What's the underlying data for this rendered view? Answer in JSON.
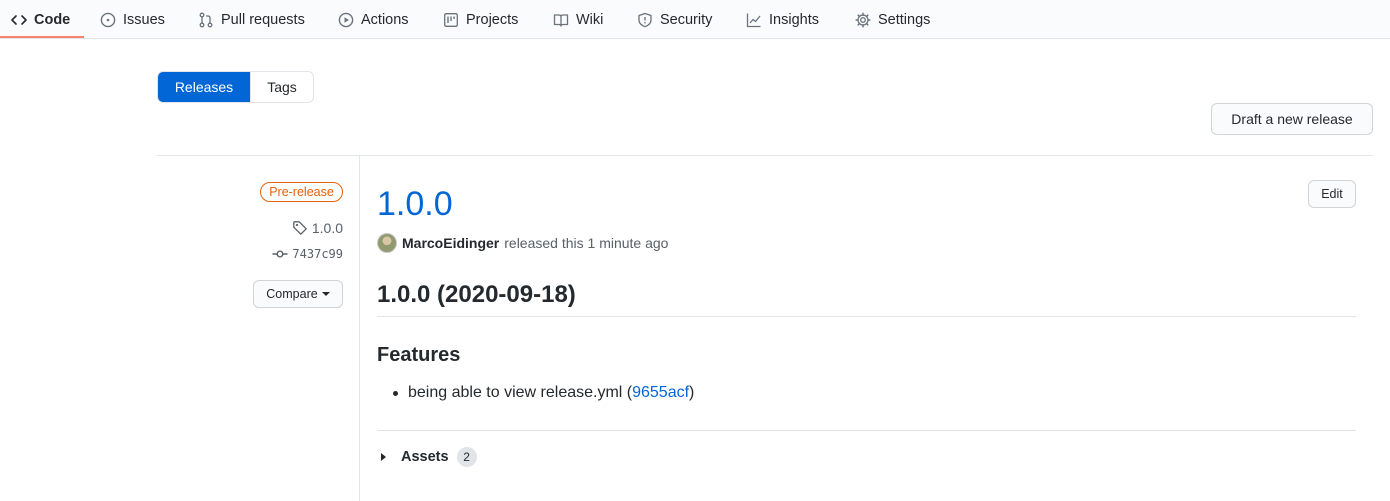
{
  "nav": {
    "tabs": [
      {
        "label": "Code",
        "icon": "code-icon"
      },
      {
        "label": "Issues",
        "icon": "issue-icon"
      },
      {
        "label": "Pull requests",
        "icon": "pull-request-icon"
      },
      {
        "label": "Actions",
        "icon": "play-icon"
      },
      {
        "label": "Projects",
        "icon": "project-icon"
      },
      {
        "label": "Wiki",
        "icon": "book-icon"
      },
      {
        "label": "Security",
        "icon": "shield-icon"
      },
      {
        "label": "Insights",
        "icon": "graph-icon"
      },
      {
        "label": "Settings",
        "icon": "gear-icon"
      }
    ],
    "selected": "Code",
    "underline_color": "#f9826c"
  },
  "subnav": {
    "releases_label": "Releases",
    "tags_label": "Tags",
    "active": "Releases"
  },
  "draft_button_label": "Draft a new release",
  "release": {
    "badge": "Pre-release",
    "tag": "1.0.0",
    "commit": "7437c99",
    "compare_label": "Compare",
    "title": "1.0.0",
    "edit_label": "Edit",
    "author": "MarcoEidinger",
    "released_text": "released this 1 minute ago",
    "notes": {
      "heading": "1.0.0 (2020-09-18)",
      "section": "Features",
      "items": [
        {
          "text": "being able to view release.yml (",
          "link": "9655acf",
          "suffix": ")"
        }
      ]
    },
    "assets_label": "Assets",
    "assets_count": "2"
  },
  "colors": {
    "link": "#0366d6",
    "prerelease": "#e36209",
    "active_tab_bg": "#0366d6"
  }
}
